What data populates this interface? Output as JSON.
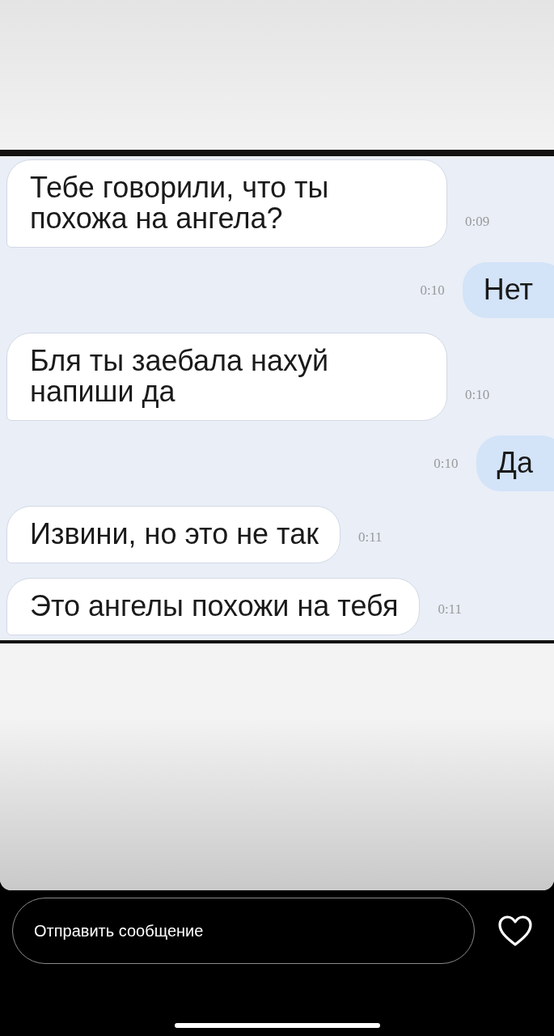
{
  "chat": {
    "messages": [
      {
        "kind": "incoming",
        "text": "Тебе говорили, что ты похожа на ангела?",
        "time": "0:09"
      },
      {
        "kind": "outgoing",
        "text": "Нет",
        "time": "0:10"
      },
      {
        "kind": "incoming",
        "text": "Бля ты заебала нахуй напиши да",
        "time": "0:10"
      },
      {
        "kind": "outgoing",
        "text": "Да",
        "time": "0:10"
      },
      {
        "kind": "incoming",
        "text": "Извини, но это не так",
        "time": "0:11"
      },
      {
        "kind": "incoming",
        "text": "Это ангелы похожи на тебя",
        "time": "0:11"
      }
    ]
  },
  "reply_bar": {
    "placeholder": "Отправить сообщение"
  }
}
